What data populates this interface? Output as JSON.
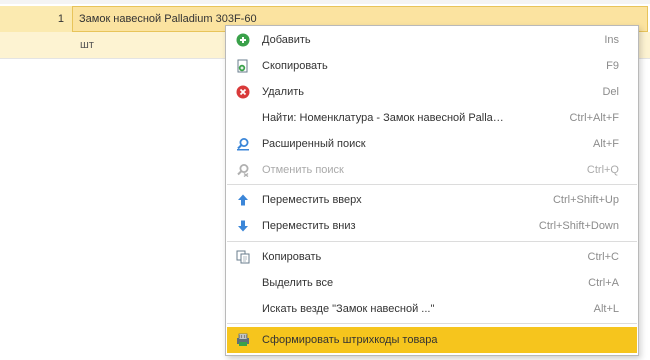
{
  "table": {
    "row_number": "1",
    "item_name": "Замок навесной Palladium 303F-60",
    "unit": "шт"
  },
  "context_menu": {
    "items": [
      {
        "label": "Добавить",
        "shortcut": "Ins",
        "icon": "add-green-circle-icon"
      },
      {
        "label": "Скопировать",
        "shortcut": "F9",
        "icon": "copy-document-icon"
      },
      {
        "label": "Удалить",
        "shortcut": "Del",
        "icon": "delete-red-circle-icon"
      },
      {
        "label": "Найти: Номенклатура - Замок навесной Palla…",
        "shortcut": "Ctrl+Alt+F",
        "icon": ""
      },
      {
        "label": "Расширенный поиск",
        "shortcut": "Alt+F",
        "icon": "advanced-search-icon"
      },
      {
        "label": "Отменить поиск",
        "shortcut": "Ctrl+Q",
        "icon": "cancel-search-icon"
      },
      {
        "label": "Переместить вверх",
        "shortcut": "Ctrl+Shift+Up",
        "icon": "arrow-up-icon"
      },
      {
        "label": "Переместить вниз",
        "shortcut": "Ctrl+Shift+Down",
        "icon": "arrow-down-icon"
      },
      {
        "label": "Копировать",
        "shortcut": "Ctrl+C",
        "icon": "copy-clipboard-icon"
      },
      {
        "label": "Выделить все",
        "shortcut": "Ctrl+A",
        "icon": ""
      },
      {
        "label": "Искать везде \"Замок навесной ...\"",
        "shortcut": "Alt+L",
        "icon": ""
      },
      {
        "label": "Сформировать штрихкоды товара",
        "shortcut": "",
        "icon": "barcode-print-icon"
      }
    ],
    "disabled_items": [
      "Отменить поиск"
    ],
    "highlighted_item": "Сформировать штрихкоды товара"
  },
  "colors": {
    "highlight": "#f6c51d",
    "selected_row": "#fbe3a0",
    "add_icon": "#3aa14a",
    "delete_icon": "#d93a3a",
    "arrow_icon": "#3b86d8"
  }
}
